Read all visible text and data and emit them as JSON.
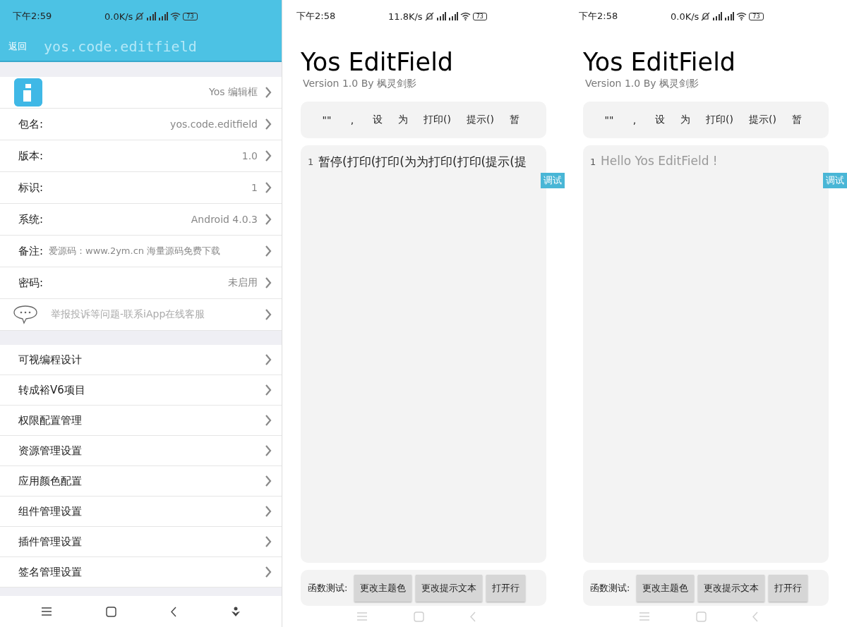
{
  "phones": [
    {
      "kind": "info",
      "status": {
        "time": "下午2:59",
        "speed": "0.0K/s",
        "battery": "73"
      },
      "header": {
        "back": "返回",
        "title": "yos.code.editfield"
      },
      "app_row": {
        "value": "Yos 编辑框"
      },
      "fields": [
        {
          "kind": "field",
          "label": "包名:",
          "value": "yos.code.editfield"
        },
        {
          "kind": "field",
          "label": "版本:",
          "value": "1.0"
        },
        {
          "kind": "field",
          "label": "标识:",
          "value": "1"
        },
        {
          "kind": "field",
          "label": "系统:",
          "value": "Android 4.0.3"
        },
        {
          "kind": "note",
          "label": "备注:",
          "value": "爱源码：www.2ym.cn 海量源码免费下载"
        },
        {
          "kind": "field",
          "label": "密码:",
          "value": "未启用"
        }
      ],
      "contact": "举报投诉等问题-联系iApp在线客服",
      "menu": [
        "可视编程设计",
        "转成裕V6项目",
        "权限配置管理",
        "资源管理设置",
        "应用颜色配置",
        "组件管理设置",
        "插件管理设置",
        "签名管理设置"
      ]
    },
    {
      "kind": "editor",
      "status": {
        "time": "下午2:58",
        "speed": "11.8K/s",
        "battery": "73"
      },
      "title": "Yos EditField",
      "subtitle": "Version 1.0 By 枫灵剑影",
      "keys": [
        "\"\"",
        ",",
        "设",
        "为",
        "打印()",
        "提示()",
        "暂"
      ],
      "editor": {
        "line": "1",
        "value": "暂停(打印(打印(为为打印(打印(提示(提"
      },
      "debug": "调试",
      "function_label": "函数测试:",
      "buttons": [
        "更改主题色",
        "更改提示文本",
        "打开行"
      ]
    },
    {
      "kind": "editor",
      "status": {
        "time": "下午2:58",
        "speed": "0.0K/s",
        "battery": "73"
      },
      "title": "Yos EditField",
      "subtitle": "Version 1.0 By 枫灵剑影",
      "keys": [
        "\"\"",
        ",",
        "设",
        "为",
        "打印()",
        "提示()",
        "暂"
      ],
      "editor": {
        "line": "1",
        "placeholder": "Hello Yos EditField !"
      },
      "debug": "调试",
      "function_label": "函数测试:",
      "buttons": [
        "更改主题色",
        "更改提示文本",
        "打开行"
      ]
    }
  ]
}
